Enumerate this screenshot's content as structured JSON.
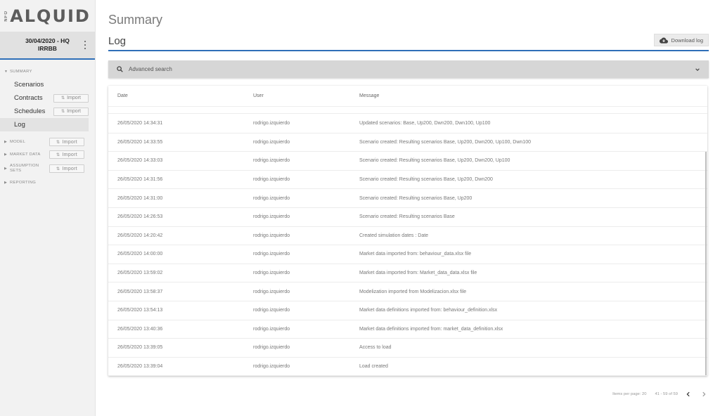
{
  "logo": {
    "small_text": "NFO",
    "main_text": "ALQUID"
  },
  "context": {
    "line1": "30/04/2020 - HQ",
    "line2": "IRRBB"
  },
  "sidebar": {
    "summary_label": "SUMMARY",
    "items": [
      {
        "label": "Scenarios"
      },
      {
        "label": "Contracts",
        "import": "Import"
      },
      {
        "label": "Schedules",
        "import": "Import"
      },
      {
        "label": "Log"
      }
    ],
    "model_label": "MODEL",
    "model_import": "Import",
    "market_label": "MARKET DATA",
    "market_import": "Import",
    "assumption_line1": "ASSUMPTION",
    "assumption_line2": "SETS",
    "assumption_import": "Import",
    "reporting_label": "REPORTING"
  },
  "main": {
    "page_title": "Summary",
    "section_title": "Log",
    "download_label": "Download log",
    "search_label": "Advanced search"
  },
  "table": {
    "columns": {
      "date": "Date",
      "user": "User",
      "message": "Message"
    },
    "rows": [
      {
        "date": "26/05/2020 14:34:31",
        "user": "rodrigo.izquierdo",
        "message": "Updated scenarios: Base, Up200, Dwn200, Dwn100, Up100"
      },
      {
        "date": "26/05/2020 14:33:55",
        "user": "rodrigo.izquierdo",
        "message": "Scenario created: Resulting scenarios Base, Up200, Dwn200, Up100, Dwn100"
      },
      {
        "date": "26/05/2020 14:33:03",
        "user": "rodrigo.izquierdo",
        "message": "Scenario created: Resulting scenarios Base, Up200, Dwn200, Up100"
      },
      {
        "date": "26/05/2020 14:31:56",
        "user": "rodrigo.izquierdo",
        "message": "Scenario created: Resulting scenarios Base, Up200, Dwn200"
      },
      {
        "date": "26/05/2020 14:31:00",
        "user": "rodrigo.izquierdo",
        "message": "Scenario created: Resulting scenarios Base, Up200"
      },
      {
        "date": "26/05/2020 14:26:53",
        "user": "rodrigo.izquierdo",
        "message": "Scenario created: Resulting scenarios Base"
      },
      {
        "date": "26/05/2020 14:20:42",
        "user": "rodrigo.izquierdo",
        "message": "Created simulation dates : Date"
      },
      {
        "date": "26/05/2020 14:00:00",
        "user": "rodrigo.izquierdo",
        "message": "Market data imported from: behaviour_data.xlsx file"
      },
      {
        "date": "26/05/2020 13:59:02",
        "user": "rodrigo.izquierdo",
        "message": "Market data imported from: Market_data_data.xlsx file"
      },
      {
        "date": "26/05/2020 13:58:37",
        "user": "rodrigo.izquierdo",
        "message": "Modelization imported from Modelizacion.xlsx file"
      },
      {
        "date": "26/05/2020 13:54:13",
        "user": "rodrigo.izquierdo",
        "message": "Market data definitions imported from: behaviour_definition.xlsx"
      },
      {
        "date": "26/05/2020 13:40:36",
        "user": "rodrigo.izquierdo",
        "message": "Market data definitions imported from: market_data_definition.xlsx"
      },
      {
        "date": "26/05/2020 13:39:05",
        "user": "rodrigo.izquierdo",
        "message": "Access to load"
      },
      {
        "date": "26/05/2020 13:39:04",
        "user": "rodrigo.izquierdo",
        "message": "Load created"
      }
    ]
  },
  "pagination": {
    "items_per_page": "Items per page: 20",
    "range": "41 - 59 of 59"
  },
  "colors": {
    "accent": "#2f6fb8",
    "sidebar_bg": "#f2f2f2",
    "search_bg": "#d6d6d6"
  },
  "icons": [
    "kebab-icon",
    "caret-down-icon",
    "caret-right-icon",
    "sort-icon",
    "cloud-download-icon",
    "search-icon",
    "chevron-down-icon",
    "chevron-left-icon",
    "chevron-right-icon"
  ]
}
